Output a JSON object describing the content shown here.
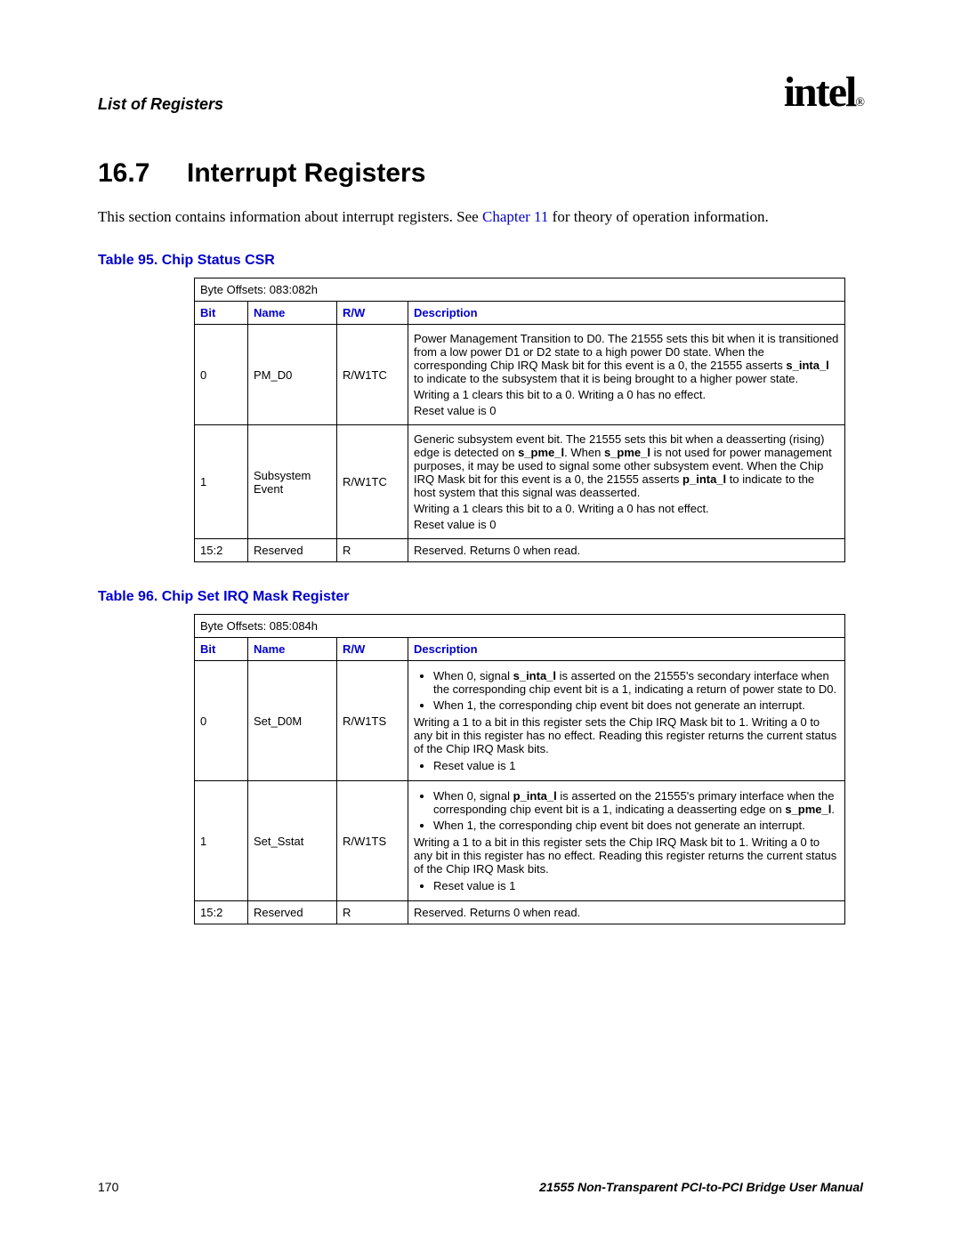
{
  "header": {
    "running_head": "List of Registers",
    "logo_text": "intel",
    "logo_mark": "®"
  },
  "section": {
    "number": "16.7",
    "title": "Interrupt Registers",
    "intro_before": "This section contains information about interrupt registers. See ",
    "intro_link": "Chapter 11",
    "intro_after": " for theory of operation information."
  },
  "table95": {
    "caption": "Table 95.  Chip Status CSR",
    "byte_offsets": "Byte Offsets: 083:082h",
    "headers": {
      "bit": "Bit",
      "name": "Name",
      "rw": "R/W",
      "desc": "Description"
    },
    "rows": [
      {
        "bit": "0",
        "name": "PM_D0",
        "rw": "R/W1TC",
        "desc_p1a": "Power Management Transition to D0. The 21555 sets this bit when it is transitioned from a low power D1 or D2 state to a high power D0 state. When the corresponding Chip IRQ Mask bit for this event is a 0, the 21555 asserts ",
        "desc_p1b": "s_inta_l",
        "desc_p1c": " to indicate to the subsystem that it is being brought to a higher power state.",
        "desc_p2": "Writing a 1 clears this bit to a 0. Writing a 0 has no effect.",
        "desc_p3": "Reset value is 0"
      },
      {
        "bit": "1",
        "name": "Subsystem Event",
        "rw": "R/W1TC",
        "desc_p1a": "Generic subsystem event bit. The 21555 sets this bit when a deasserting (rising) edge is detected on ",
        "desc_p1b": "s_pme_l",
        "desc_p1c": ". When ",
        "desc_p1d": "s_pme_l",
        "desc_p1e": " is not used for power management purposes, it may be used to signal some other subsystem event. When the Chip IRQ Mask bit for this event is a 0, the 21555 asserts ",
        "desc_p1f": "p_inta_l",
        "desc_p1g": " to indicate to the host system that this signal was deasserted.",
        "desc_p2": "Writing a 1 clears this bit to a 0. Writing a 0 has not effect.",
        "desc_p3": "Reset value is 0"
      },
      {
        "bit": "15:2",
        "name": "Reserved",
        "rw": "R",
        "desc": "Reserved. Returns 0 when read."
      }
    ]
  },
  "table96": {
    "caption": "Table 96.  Chip Set IRQ Mask Register",
    "byte_offsets": "Byte Offsets: 085:084h",
    "headers": {
      "bit": "Bit",
      "name": "Name",
      "rw": "R/W",
      "desc": "Description"
    },
    "rows": [
      {
        "bit": "0",
        "name": "Set_D0M",
        "rw": "R/W1TS",
        "b1a": "When 0, signal ",
        "b1b": "s_inta_l",
        "b1c": " is asserted on the 21555's secondary interface when the corresponding chip event bit is a 1, indicating a return of power state to D0.",
        "b2": "When 1, the corresponding chip event bit does not generate an interrupt.",
        "p1": "Writing a 1 to a bit in this register sets the Chip IRQ Mask bit to 1. Writing a 0 to any bit in this register has no effect. Reading this register returns the current status of the Chip IRQ Mask bits.",
        "b3": "Reset value is 1"
      },
      {
        "bit": "1",
        "name": "Set_Sstat",
        "rw": "R/W1TS",
        "b1a": "When 0, signal ",
        "b1b": "p_inta_l",
        "b1c": " is asserted on the 21555's primary interface when the corresponding chip event bit is a 1, indicating a deasserting edge on ",
        "b1d": "s_pme_l",
        "b1e": ".",
        "b2": "When 1, the corresponding chip event bit does not generate an interrupt.",
        "p1": "Writing a 1 to a bit in this register sets the Chip IRQ Mask bit to 1. Writing a 0 to any bit in this register has no effect. Reading this register returns the current status of the Chip IRQ Mask bits.",
        "b3": "Reset value is 1"
      },
      {
        "bit": "15:2",
        "name": "Reserved",
        "rw": "R",
        "desc": "Reserved. Returns 0 when read."
      }
    ]
  },
  "footer": {
    "page": "170",
    "manual": "21555 Non-Transparent PCI-to-PCI Bridge User Manual"
  }
}
